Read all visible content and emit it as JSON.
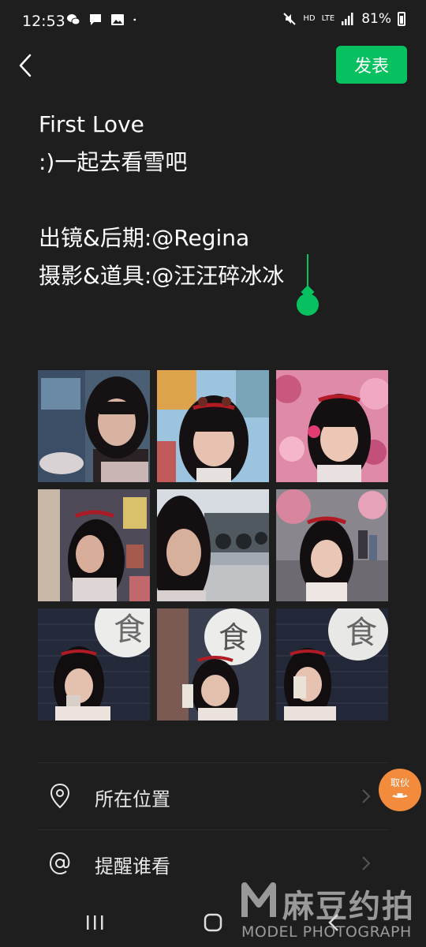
{
  "status_bar": {
    "time": "12:53",
    "network_hd": "HD",
    "network_lte": "LTE",
    "battery": "81%",
    "icons": [
      "wechat-icon",
      "message-icon",
      "gallery-icon",
      "dot-icon",
      "mute-icon",
      "signal-icon",
      "battery-icon"
    ]
  },
  "header": {
    "back_icon": "chevron-left-icon",
    "publish_label": "发表"
  },
  "post": {
    "lines": [
      "First Love",
      ":)一起去看雪吧",
      "",
      "出镜&后期:@Regina",
      "摄影&道具:@汪汪碎冰冰"
    ]
  },
  "photos": {
    "count": 9
  },
  "options": [
    {
      "icon": "location-pin-icon",
      "label": "所在位置"
    },
    {
      "icon": "at-sign-icon",
      "label": "提醒谁看"
    }
  ],
  "float_badge": {
    "label": "取伙"
  },
  "watermark": {
    "brand": "麻豆约拍",
    "sub": "MODEL PHOTOGRAPH"
  },
  "colors": {
    "background": "#1e1e1e",
    "accent": "#07c160",
    "badge": "#f28c3c"
  }
}
